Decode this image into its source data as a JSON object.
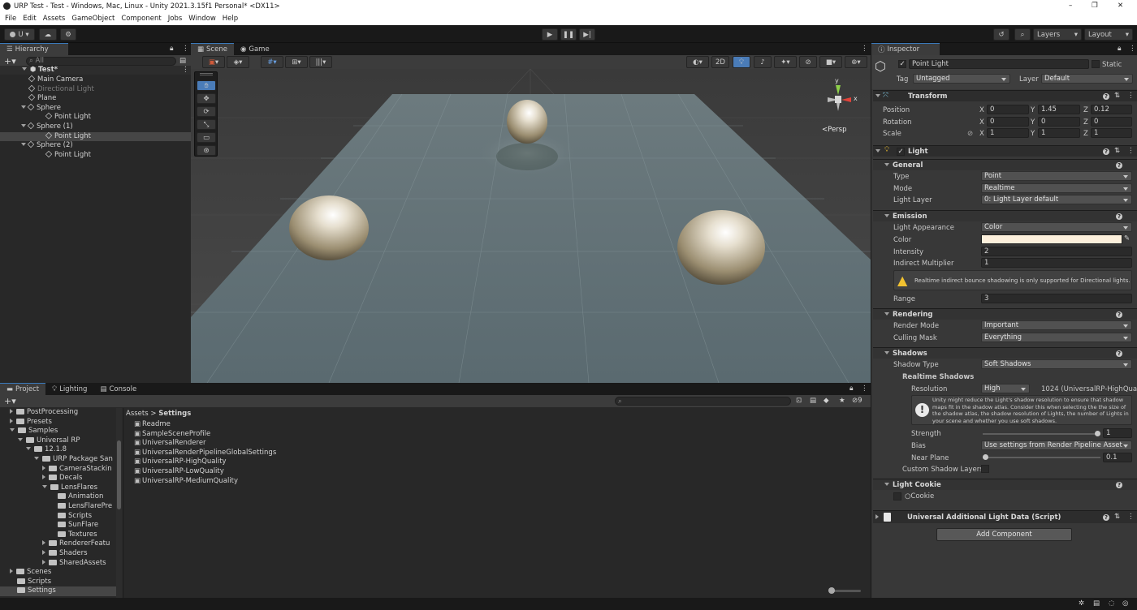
{
  "window": {
    "title": "URP Test - Test - Windows, Mac, Linux - Unity 2021.3.15f1 Personal* <DX11>",
    "minimize": "–",
    "maximize": "❐",
    "close": "✕"
  },
  "menu": [
    "File",
    "Edit",
    "Assets",
    "GameObject",
    "Component",
    "Jobs",
    "Window",
    "Help"
  ],
  "toolbar": {
    "account": "U",
    "layers": "Layers",
    "layout": "Layout"
  },
  "hierarchy": {
    "tab": "Hierarchy",
    "search_placeholder": "All",
    "scene": "Test*",
    "items": [
      {
        "label": "Main Camera",
        "indent": 1,
        "dim": false
      },
      {
        "label": "Directional Light",
        "indent": 1,
        "dim": true
      },
      {
        "label": "Plane",
        "indent": 1,
        "dim": false
      },
      {
        "label": "Sphere",
        "indent": 1,
        "dim": false,
        "expanded": true
      },
      {
        "label": "Point Light",
        "indent": 2,
        "dim": false
      },
      {
        "label": "Sphere (1)",
        "indent": 1,
        "dim": false,
        "expanded": true
      },
      {
        "label": "Point Light",
        "indent": 2,
        "dim": false,
        "selected": true
      },
      {
        "label": "Sphere (2)",
        "indent": 1,
        "dim": false,
        "expanded": true
      },
      {
        "label": "Point Light",
        "indent": 2,
        "dim": false
      }
    ]
  },
  "scene": {
    "tab_scene": "Scene",
    "tab_game": "Game",
    "btn_2d": "2D",
    "persp": "<Persp",
    "axis_y": "y",
    "axis_x": "x"
  },
  "project": {
    "tabs": [
      "Project",
      "Lighting",
      "Console"
    ],
    "badge": "9",
    "breadcrumb": [
      "Assets",
      "Settings"
    ],
    "tree": [
      {
        "label": "PostProcessing",
        "indent": 1,
        "arrow": "right"
      },
      {
        "label": "Presets",
        "indent": 1,
        "arrow": "right"
      },
      {
        "label": "Samples",
        "indent": 1,
        "arrow": "down"
      },
      {
        "label": "Universal RP",
        "indent": 2,
        "arrow": "down"
      },
      {
        "label": "12.1.8",
        "indent": 3,
        "arrow": "down"
      },
      {
        "label": "URP Package San",
        "indent": 4,
        "arrow": "down"
      },
      {
        "label": "CameraStackin",
        "indent": 5,
        "arrow": "right"
      },
      {
        "label": "Decals",
        "indent": 5,
        "arrow": "right"
      },
      {
        "label": "LensFlares",
        "indent": 5,
        "arrow": "down"
      },
      {
        "label": "Animation",
        "indent": 6,
        "arrow": "none"
      },
      {
        "label": "LensFlarePre",
        "indent": 6,
        "arrow": "none"
      },
      {
        "label": "Scripts",
        "indent": 6,
        "arrow": "none"
      },
      {
        "label": "SunFlare",
        "indent": 6,
        "arrow": "none"
      },
      {
        "label": "Textures",
        "indent": 6,
        "arrow": "none"
      },
      {
        "label": "RendererFeatu",
        "indent": 5,
        "arrow": "right"
      },
      {
        "label": "Shaders",
        "indent": 5,
        "arrow": "right"
      },
      {
        "label": "SharedAssets",
        "indent": 5,
        "arrow": "right"
      },
      {
        "label": "Scenes",
        "indent": 1,
        "arrow": "right"
      },
      {
        "label": "Scripts",
        "indent": 1,
        "arrow": "none"
      },
      {
        "label": "Settings",
        "indent": 1,
        "arrow": "none",
        "selected": true
      }
    ],
    "files": [
      "Readme",
      "SampleSceneProfile",
      "UniversalRenderer",
      "UniversalRenderPipelineGlobalSettings",
      "UniversalRP-HighQuality",
      "UniversalRP-LowQuality",
      "UniversalRP-MediumQuality"
    ]
  },
  "inspector": {
    "tab": "Inspector",
    "object_name": "Point Light",
    "static_label": "Static",
    "tag_label": "Tag",
    "tag_value": "Untagged",
    "layer_label": "Layer",
    "layer_value": "Default",
    "transform": {
      "title": "Transform",
      "position_label": "Position",
      "rotation_label": "Rotation",
      "scale_label": "Scale",
      "position": {
        "x": "0",
        "y": "1.45",
        "z": "0.12"
      },
      "rotation": {
        "x": "0",
        "y": "0",
        "z": "0"
      },
      "scale": {
        "x": "1",
        "y": "1",
        "z": "1"
      }
    },
    "light": {
      "title": "Light",
      "general": "General",
      "type_label": "Type",
      "type_value": "Point",
      "mode_label": "Mode",
      "mode_value": "Realtime",
      "layer_label": "Light Layer",
      "layer_value": "0: Light Layer default",
      "emission": "Emission",
      "appearance_label": "Light Appearance",
      "appearance_value": "Color",
      "color_label": "Color",
      "color_value": "#fdf0dc",
      "intensity_label": "Intensity",
      "intensity_value": "2",
      "indirect_label": "Indirect Multiplier",
      "indirect_value": "1",
      "warning": "Realtime indirect bounce shadowing is only supported for Directional lights.",
      "range_label": "Range",
      "range_value": "3",
      "rendering": "Rendering",
      "render_mode_label": "Render Mode",
      "render_mode_value": "Important",
      "culling_label": "Culling Mask",
      "culling_value": "Everything",
      "shadows": "Shadows",
      "shadow_type_label": "Shadow Type",
      "shadow_type_value": "Soft Shadows",
      "realtime_shadows": "Realtime Shadows",
      "resolution_label": "Resolution",
      "resolution_value": "High",
      "resolution_text": "1024 (UniversalRP-HighQua",
      "info": "Unity might reduce the Light's shadow resolution to ensure that shadow maps fit in the shadow atlas. Consider this when selecting the the size of the shadow atlas, the shadow resolution of Lights, the number of Lights in your scene and whether you use soft shadows.",
      "strength_label": "Strength",
      "strength_value": "1",
      "strength_fraction": 1.0,
      "bias_label": "Bias",
      "bias_value": "Use settings from Render Pipeline Asset",
      "near_label": "Near Plane",
      "near_value": "0.1",
      "near_fraction": 0.0,
      "custom_label": "Custom Shadow Layers",
      "cookie": "Light Cookie",
      "cookie_label": "Cookie"
    },
    "additional": "Universal Additional Light Data (Script)",
    "add_component": "Add Component"
  }
}
